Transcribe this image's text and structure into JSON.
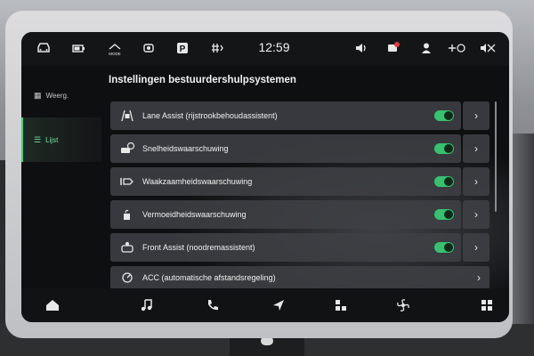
{
  "statusbar": {
    "clock": "12:59",
    "icons": [
      "car-icon",
      "battery-icon",
      "drive-mode-icon",
      "assist-icon",
      "parking-icon",
      "climate-icon",
      "volume-icon",
      "notification-icon",
      "user-icon",
      "connectivity-icon",
      "sound-mute-icon"
    ],
    "mode_label": "MODE"
  },
  "sidebar": {
    "items": [
      {
        "label": "Weerg.",
        "icon": "display-icon",
        "active": false
      },
      {
        "label": "Lijst",
        "icon": "list-icon",
        "active": true
      }
    ]
  },
  "page": {
    "title": "Instellingen bestuurdershulpsystemen"
  },
  "list": {
    "items": [
      {
        "label": "Lane Assist (rijstrookbehoudassistent)",
        "icon": "lane-assist-icon",
        "toggle": true
      },
      {
        "label": "Snelheidswaarschuwing",
        "icon": "speed-warning-icon",
        "toggle": true
      },
      {
        "label": "Waakzaamheidswaarschuwing",
        "icon": "attention-warning-icon",
        "toggle": true
      },
      {
        "label": "Vermoeidheidswaarschuwing",
        "icon": "fatigue-warning-icon",
        "toggle": true
      },
      {
        "label": "Front Assist (noodremassistent)",
        "icon": "front-assist-icon",
        "toggle": true
      },
      {
        "label": "ACC (automatische afstandsregeling)",
        "icon": "acc-icon",
        "toggle": false
      }
    ]
  },
  "bottomnav": {
    "items": [
      "home-icon",
      "music-icon",
      "phone-icon",
      "navigation-icon",
      "apps-icon",
      "fan-icon",
      "grid-icon"
    ]
  },
  "colors": {
    "accent": "#3ecf7a",
    "row_bg": "#3e4044",
    "screen_bg": "#0e0f11"
  }
}
